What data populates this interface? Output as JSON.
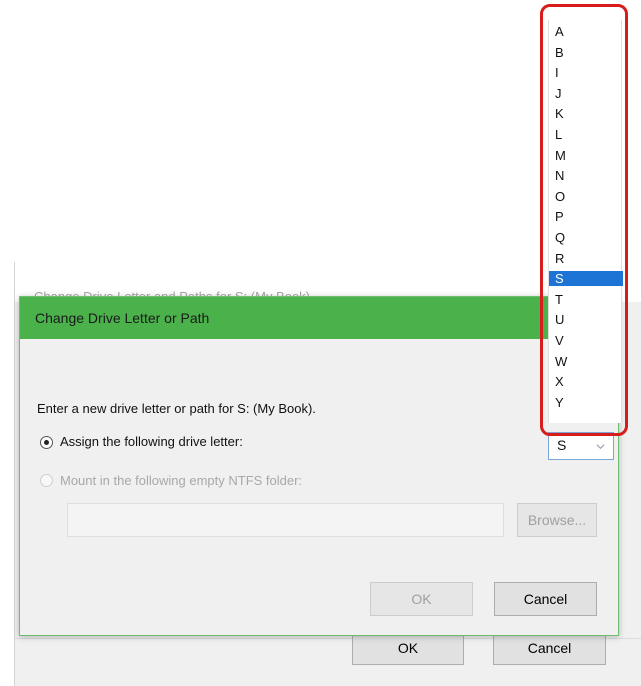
{
  "outer_dialog": {
    "title": "Change Drive Letter and Paths for S: (My Book)",
    "ok_label": "OK",
    "cancel_label": "Cancel"
  },
  "inner_dialog": {
    "title": "Change Drive Letter or Path",
    "prompt": "Enter a new drive letter or path for S: (My Book).",
    "assign_option": "Assign the following drive letter:",
    "mount_option": "Mount in the following empty NTFS folder:",
    "folder_path_value": "",
    "browse_label": "Browse...",
    "ok_label": "OK",
    "cancel_label": "Cancel"
  },
  "drive_letter_combo": {
    "value": "S"
  },
  "drive_letter_list": {
    "items": [
      "A",
      "B",
      "I",
      "J",
      "K",
      "L",
      "M",
      "N",
      "O",
      "P",
      "Q",
      "R",
      "S",
      "T",
      "U",
      "V",
      "W",
      "X",
      "Y"
    ],
    "selected": "S"
  },
  "colors": {
    "title_bar_green": "#4bb14b",
    "selection_blue": "#1d74d4",
    "highlight_red": "#d81b1b"
  }
}
